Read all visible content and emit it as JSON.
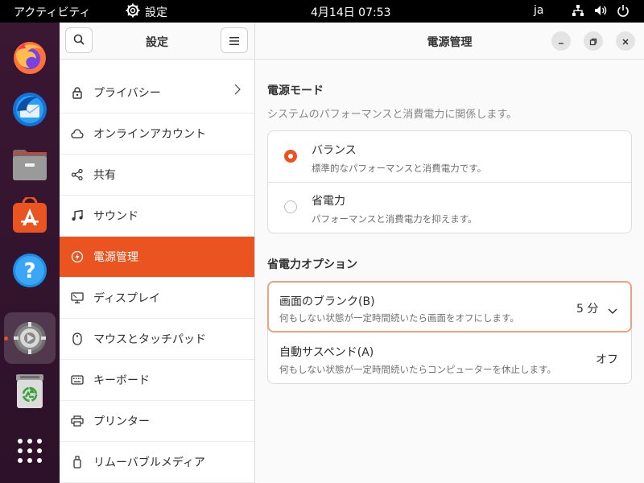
{
  "topbar": {
    "activities": "アクティビティ",
    "app_name": "設定",
    "clock": "4月14日  07:53",
    "input_method": "ja"
  },
  "dock": {
    "items": [
      "firefox-icon",
      "thunderbird-icon",
      "files-icon",
      "app-center-icon",
      "help-icon",
      "settings-icon",
      "trash-icon",
      "app-grid-icon"
    ]
  },
  "sidebar": {
    "title": "設定",
    "items": [
      {
        "label": "プライバシー"
      },
      {
        "label": "オンラインアカウント"
      },
      {
        "label": "共有"
      },
      {
        "label": "サウンド"
      },
      {
        "label": "電源管理"
      },
      {
        "label": "ディスプレイ"
      },
      {
        "label": "マウスとタッチパッド"
      },
      {
        "label": "キーボード"
      },
      {
        "label": "プリンター"
      },
      {
        "label": "リムーバブルメディア"
      }
    ]
  },
  "main": {
    "title": "電源管理",
    "power_mode": {
      "title": "電源モード",
      "description": "システムのパフォーマンスと消費電力に関係します。",
      "options": [
        {
          "title": "バランス",
          "subtitle": "標準的なパフォーマンスと消費電力です。",
          "selected": true
        },
        {
          "title": "省電力",
          "subtitle": "パフォーマンスと消費電力を抑えます。",
          "selected": false
        }
      ]
    },
    "power_saving": {
      "title": "省電力オプション",
      "blank_screen": {
        "title": "画面のブランク(B)",
        "subtitle": "何もしない状態が一定時間続いたら画面をオフにします。",
        "value": "5 分"
      },
      "auto_suspend": {
        "title": "自動サスペンド(A)",
        "subtitle": "何もしない状態が一定時間続いたらコンピューターを休止します。",
        "value": "オフ"
      }
    }
  },
  "colors": {
    "accent": "#e95420",
    "dock": "#2f1428"
  }
}
